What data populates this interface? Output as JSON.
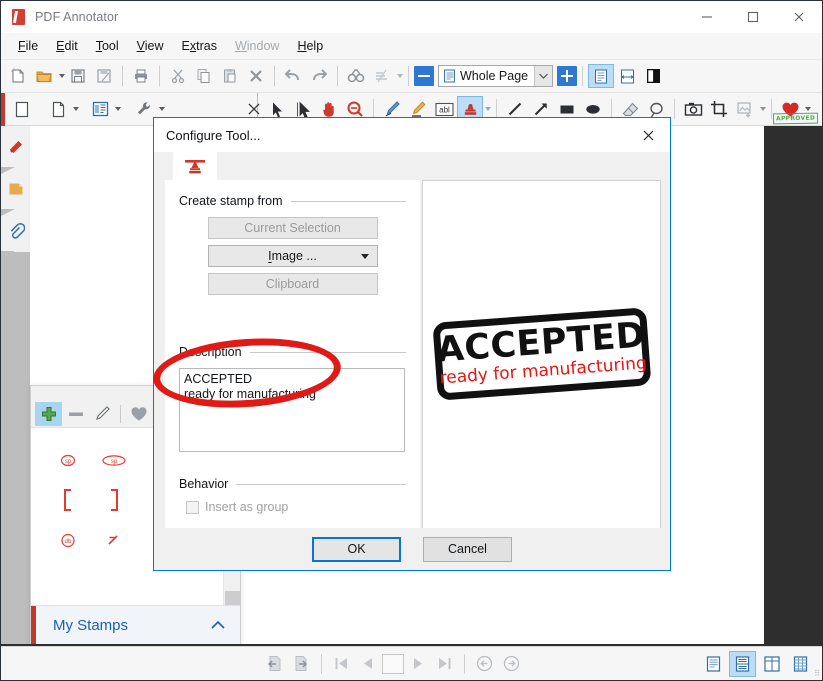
{
  "window": {
    "title": "PDF Annotator",
    "app_icon": "pdf-annotator-logo",
    "controls": {
      "minimize": "minimize-icon",
      "maximize": "maximize-icon",
      "close": "close-icon"
    }
  },
  "menubar": {
    "items": [
      {
        "label": "File",
        "mnemonic": "F",
        "disabled": false
      },
      {
        "label": "Edit",
        "mnemonic": "E",
        "disabled": false
      },
      {
        "label": "Tool",
        "mnemonic": "T",
        "disabled": false
      },
      {
        "label": "View",
        "mnemonic": "V",
        "disabled": false
      },
      {
        "label": "Extras",
        "mnemonic": "x",
        "disabled": false
      },
      {
        "label": "Window",
        "mnemonic": "W",
        "disabled": true
      },
      {
        "label": "Help",
        "mnemonic": "H",
        "disabled": false
      }
    ]
  },
  "toolbar_main": {
    "items": [
      "new-document-icon",
      "open-folder-icon",
      "open-dropdown-caret",
      "save-icon",
      "save-as-icon",
      "print-icon",
      "cut-icon",
      "copy-icon",
      "paste-icon",
      "delete-icon",
      "undo-icon",
      "redo-icon",
      "find-icon",
      "ocr-icon",
      "ocr-dropdown-caret"
    ],
    "zoom_out_label": "zoom-out-icon",
    "zoom_in_label": "zoom-in-icon",
    "zoom_value": "Whole Page",
    "view_single_page_icon": "single-page-view-icon",
    "view_fit_width_icon": "fit-width-view-icon",
    "view_dual_icon": "dual-page-view-icon"
  },
  "toolbar_tools": {
    "left_items": [
      "page-thumbnail-icon",
      "new-page-icon",
      "new-page-caret",
      "page-library-icon",
      "page-library-caret",
      "settings-wrench-icon",
      "settings-caret",
      "close-panel-icon"
    ],
    "right_items": [
      "select-arrow-icon",
      "lasso-select-icon",
      "hand-pan-icon",
      "magnifier-icon",
      "pen-icon",
      "highlighter-icon",
      "text-box-icon",
      "stamp-icon",
      "stamp-caret",
      "line-icon",
      "arrow-icon",
      "rectangle-icon",
      "ellipse-icon",
      "eraser-icon",
      "freehand-loop-icon",
      "camera-snapshot-icon",
      "crop-icon",
      "insert-image-icon",
      "insert-image-caret",
      "favorite-heart-icon",
      "favorite-caret"
    ],
    "active_tool": "stamp-icon"
  },
  "document": {
    "page_stamp_label": "APPROVED"
  },
  "side_tabs": {
    "items": [
      "bookmark-icon",
      "sticky-note-icon",
      "attachment-clip-icon"
    ]
  },
  "stamps_panel": {
    "toolbar": [
      "add-stamp-icon",
      "remove-stamp-icon",
      "edit-stamp-icon",
      "favorite-heart-icon"
    ],
    "active_toolbar_item": "add-stamp-icon",
    "stamp_marks": [
      "sp-mark",
      "sp2-mark",
      "ic-mark",
      "del-mark",
      "bracket-left-mark",
      "bracket-right-mark",
      "paragraph-mark",
      "break-mark",
      "db-mark",
      "slash-mark"
    ],
    "footer_label": "My Stamps",
    "footer_chevron": "chevron-up-icon"
  },
  "dialog": {
    "title": "Configure Tool...",
    "close_icon": "close-icon",
    "tab_icon": "stamp-tab-icon",
    "create_stamp_from": {
      "group_label": "Create stamp from",
      "buttons": [
        {
          "label": "Current Selection",
          "enabled": false,
          "dropdown": false
        },
        {
          "label": "Image ...",
          "enabled": true,
          "dropdown": true,
          "mnemonic": "I"
        },
        {
          "label": "Clipboard",
          "enabled": false,
          "dropdown": false
        }
      ]
    },
    "description": {
      "group_label": "Description",
      "value": "ACCEPTED\nready for manufacturing"
    },
    "behavior": {
      "group_label": "Behavior",
      "checkbox_label": "Insert as group",
      "checked": false,
      "enabled": false
    },
    "preview": {
      "line1": "ACCEPTED",
      "line2": "ready for manufacturing",
      "line1_color": "#111111",
      "line2_color": "#e8140f"
    },
    "footer": {
      "ok_label": "OK",
      "cancel_label": "Cancel",
      "default_button": "OK"
    }
  },
  "annotation": {
    "ink_circle_color": "#e01b15"
  },
  "statusbar": {
    "left_items": [
      "previous-view-icon",
      "next-view-icon"
    ],
    "nav_items": [
      "first-page-icon",
      "previous-page-icon",
      "page-number-box",
      "next-page-icon",
      "last-page-icon"
    ],
    "history_items": [
      "back-icon",
      "forward-icon"
    ],
    "layout_items": [
      "single-page-layout-icon",
      "continuous-layout-icon",
      "facing-layout-icon",
      "grid-layout-icon"
    ],
    "active_layout": "continuous-layout-icon",
    "resize_grip": "resize-grip-icon"
  },
  "colors": {
    "accent_blue": "#0078d7",
    "toolbar_bg": "#f6f6f6",
    "doc_bg": "#2e2e2e",
    "stamp_red": "#c0392b",
    "highlight_blue": "#bcddf5"
  }
}
